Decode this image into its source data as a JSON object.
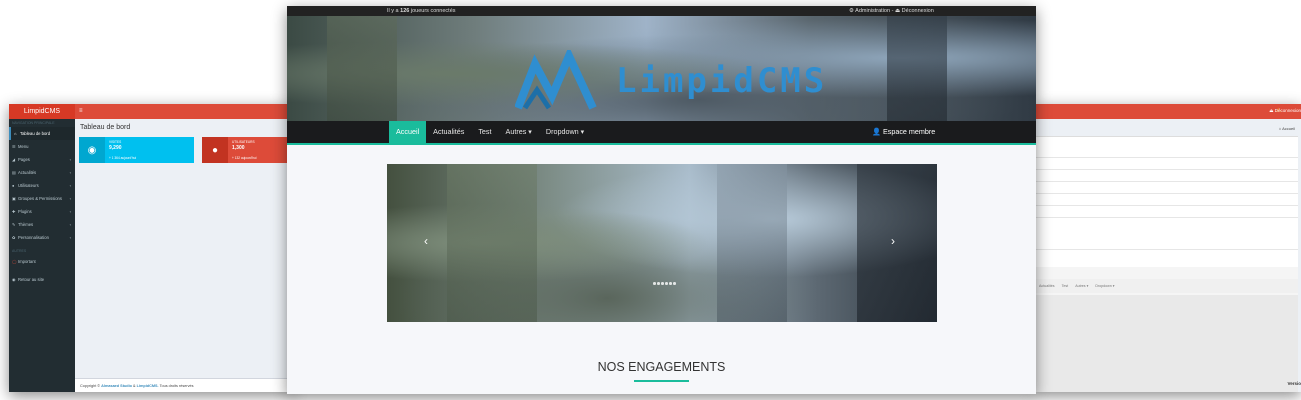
{
  "colors": {
    "admin_header": "#dd4b39",
    "admin_sidebar": "#222d32",
    "accent_teal": "#1abc9c",
    "box_blue": "#00c0ef",
    "box_red": "#dd4b39",
    "site_nav": "#1a1b1d",
    "logo_blue": "#2f8ed0"
  },
  "admin": {
    "logo": "LimpidCMS",
    "menu_icon": "≡",
    "sidebar_heading": "NAVIGATION PRINCIPALE",
    "sidebar_items": [
      {
        "label": "Tableau de bord",
        "icon": "dashboard-icon"
      },
      {
        "label": "Menu",
        "icon": "menu-icon"
      },
      {
        "label": "Pages",
        "icon": "pages-icon"
      },
      {
        "label": "Actualités",
        "icon": "news-icon"
      },
      {
        "label": "Utilisateurs",
        "icon": "users-icon"
      },
      {
        "label": "Groupes & Permissions",
        "icon": "groups-icon"
      },
      {
        "label": "Plugins",
        "icon": "plugins-icon"
      },
      {
        "label": "Thèmes",
        "icon": "themes-icon"
      },
      {
        "label": "Personnalisation",
        "icon": "customize-icon"
      }
    ],
    "sidebar_heading2": "AUTRES",
    "sidebar_items2": [
      {
        "label": "Important",
        "icon": "important-icon"
      },
      {
        "label": "Retour au site",
        "icon": "back-icon"
      }
    ],
    "page_title": "Tableau de bord",
    "boxes": [
      {
        "label": "VISITES",
        "value": "9,290",
        "sub": "+ 1 364 aujourd'hui",
        "icon": "eye-icon"
      },
      {
        "label": "UTILISATEURS",
        "value": "1,300",
        "sub": "+ 132 aujourd'hui",
        "icon": "user-icon"
      }
    ],
    "footer_prefix": "Copyright ©",
    "footer_studio": "Almasaed Studio",
    "footer_mid": "&",
    "footer_cms": "LimpidCMS.",
    "footer_suffix": "Tous droits réservés"
  },
  "admin2": {
    "logout": "Déconnexion",
    "breadcrumb": "Accueil",
    "nav_items": [
      "Actualités",
      "Test",
      "Autres ▾",
      "Dropdown ▾"
    ],
    "version": "Versio"
  },
  "site": {
    "players_prefix": "Il y a",
    "players_count": "126",
    "players_suffix": "joueurs connectés",
    "admin_link": "Administration",
    "logout_link": "Déconnexion",
    "separator": "-",
    "logo_text": "LimpidCMS",
    "nav": [
      "Accueil",
      "Actualités",
      "Test",
      "Autres ▾",
      "Dropdown ▾"
    ],
    "member_link": "Espace membre",
    "prev_arrow": "‹",
    "next_arrow": "›",
    "section_title": "NOS ENGAGEMENTS"
  }
}
